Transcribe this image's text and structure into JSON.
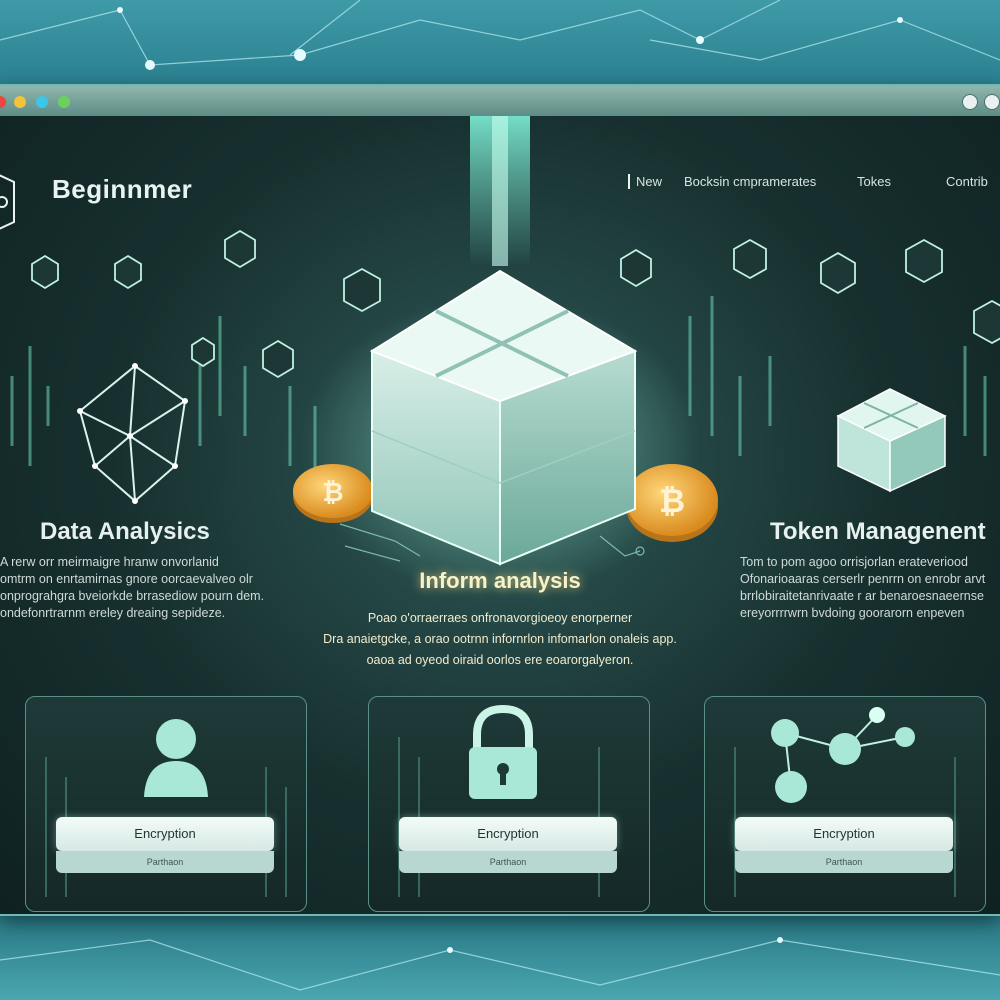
{
  "header": {
    "brand": "Beginnmer",
    "nav": [
      "New",
      "Bocksin cmpramerates",
      "Tokes",
      "Contrib"
    ]
  },
  "sections": {
    "left": {
      "title": "Data Analysics",
      "lines": [
        "A rerw orr meirmaigre hranw onvorlanid",
        "omtrm on enrtamirnas gnore oorcaevalveo olr",
        "onprograhgra bveiorkde brrasediow pourn dem.",
        "ondefonrtrarnm ereley dreaing sepideze."
      ]
    },
    "center": {
      "title": "Inform analysis",
      "lines": [
        "Poao o'orraerraes onfronavorgioeoy enorperner",
        "Dra anaietgcke, a orao ootrnn infornrlon infomarlon onaleis app.",
        "oaoa ad oyeod oiraid oorlos ere eoarorgalyeron."
      ]
    },
    "right": {
      "title": "Token Managenent",
      "lines": [
        "Tom to pom agoo orrisjorlan erateveriood",
        "Ofonarioaaras cerserlr penrrn on enrobr arvt",
        "brrlobiraitetanrivaate r ar benaroesnaeernse",
        "ereyorrrrwrn bvdoing goorarorn enpeven"
      ]
    }
  },
  "cards": [
    {
      "button": "Encryption",
      "sub": "Parthaon",
      "icon": "user-icon"
    },
    {
      "button": "Encryption",
      "sub": "Parthaon",
      "icon": "lock-icon"
    },
    {
      "button": "Encryption",
      "sub": "Parthaon",
      "icon": "network-icon"
    }
  ],
  "colors": {
    "accent": "#7ee0c9",
    "coin": "#f2a93b",
    "traffic_lights": [
      "#e9473f",
      "#f1c23a",
      "#3cc6e8",
      "#6bd15a"
    ]
  }
}
